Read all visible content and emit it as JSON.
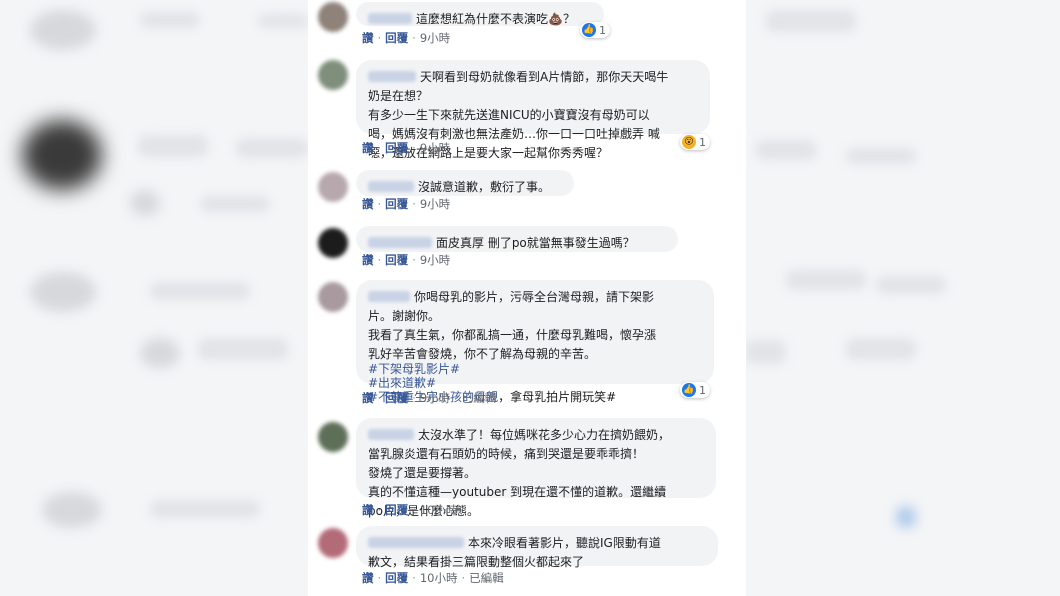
{
  "actions": {
    "reply": "讚",
    "respond": "回覆",
    "sep": "·"
  },
  "comments": [
    {
      "text": "這麼想紅為什麼不表演吃💩？",
      "time": "9小時",
      "edited": "",
      "reaction": "like",
      "reaction_count": "1"
    },
    {
      "text": "天啊看到母奶就像看到A片情節，那你天天喝牛\n奶是在想？\n有多少一生下來就先送進NICU的小寶寶沒有母奶可以\n喝，媽媽沒有刺激也無法產奶…你一口一口吐掉戲弄 喊\n噁，還放在網路上是要大家一起幫你秀秀喔？",
      "time": "9小時",
      "edited": "",
      "reaction": "wow",
      "reaction_count": "1"
    },
    {
      "text": "沒誠意道歉，敷衍了事。",
      "time": "9小時",
      "edited": "",
      "reaction": "",
      "reaction_count": ""
    },
    {
      "text": "面皮真厚 刪了po就當無事發生過嗎？",
      "time": "9小時",
      "edited": "",
      "reaction": "",
      "reaction_count": ""
    },
    {
      "text": "你喝母乳的影片，污辱全台灣母親，請下架影\n片。謝謝你。\n我看了真生氣，你都亂搞一通，什麼母乳難喝，懷孕漲\n乳好辛苦會發燒，你不了解為母親的辛苦。",
      "tags": [
        "#下架母乳影片#",
        "#出來道歉#",
        "#不尊重生完小孩的母親"
      ],
      "tag_tail": "，拿母乳拍片開玩笑#",
      "time": "9小時",
      "edited": "已編輯",
      "reaction": "like",
      "reaction_count": "1"
    },
    {
      "text": "太沒水準了！每位媽咪花多少心力在擠奶餵奶，\n當乳腺炎還有石頭奶的時候，痛到哭還是要乖乖擠！\n發燒了還是要撐著。\n真的不懂這種—youtuber 到現在還不懂的道歉。還繼續\npo片，是什麼心態。",
      "time": "10小時",
      "edited": "",
      "reaction": "",
      "reaction_count": ""
    },
    {
      "text": "本來冷眼看著影片，聽說IG限動有道\n歉文，結果看掛三篇限動整個火都起來了",
      "time": "10小時",
      "edited": "已編輯",
      "reaction": "",
      "reaction_count": ""
    }
  ]
}
